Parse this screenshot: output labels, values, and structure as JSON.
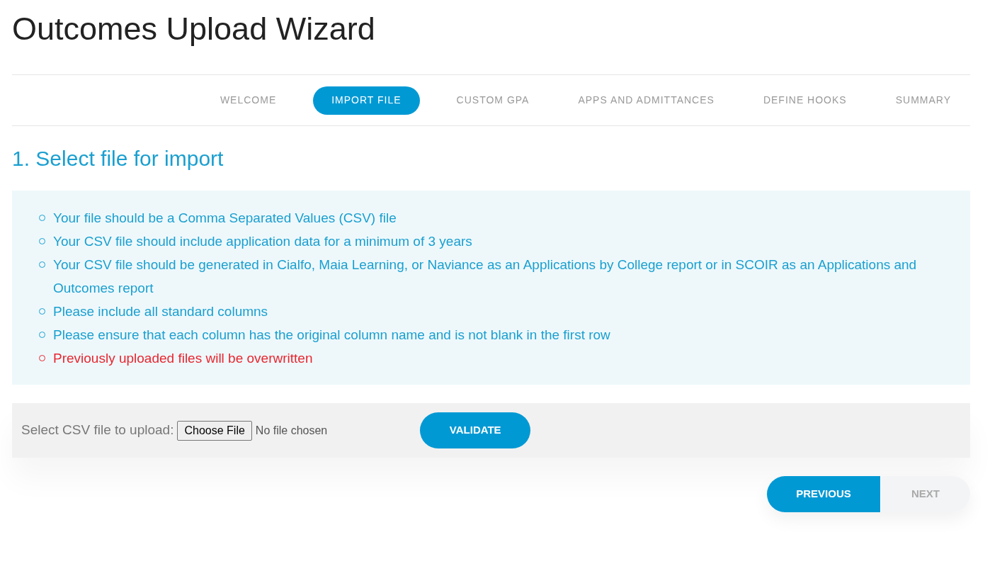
{
  "title": "Outcomes Upload Wizard",
  "steps": [
    {
      "label": "WELCOME",
      "selected": false
    },
    {
      "label": "IMPORT FILE",
      "selected": true
    },
    {
      "label": "CUSTOM GPA",
      "selected": false
    },
    {
      "label": "APPS AND ADMITTANCES",
      "selected": false
    },
    {
      "label": "DEFINE HOOKS",
      "selected": false
    },
    {
      "label": "SUMMARY",
      "selected": false
    }
  ],
  "section_heading": "1. Select file for import",
  "instructions": [
    {
      "kind": "info",
      "text": "Your file should be a Comma Separated Values (CSV) file"
    },
    {
      "kind": "info",
      "text": "Your CSV file should include application data for a minimum of 3 years"
    },
    {
      "kind": "info",
      "text": "Your CSV file should be generated in Cialfo, Maia Learning, or Naviance as an Applications by College report or in SCOIR as an Applications and Outcomes report"
    },
    {
      "kind": "info",
      "text": "Please include all standard columns"
    },
    {
      "kind": "info",
      "text": "Please ensure that each column has the original column name and is not blank in the first row"
    },
    {
      "kind": "warning",
      "text": "Previously uploaded files will be overwritten"
    }
  ],
  "upload": {
    "label": "Select CSV file to upload:",
    "choose_button": "Choose File",
    "file_status": "No file chosen",
    "validate_button": "VALIDATE"
  },
  "nav": [
    {
      "label": "PREVIOUS",
      "disabled": false
    },
    {
      "label": "NEXT",
      "disabled": true
    }
  ]
}
